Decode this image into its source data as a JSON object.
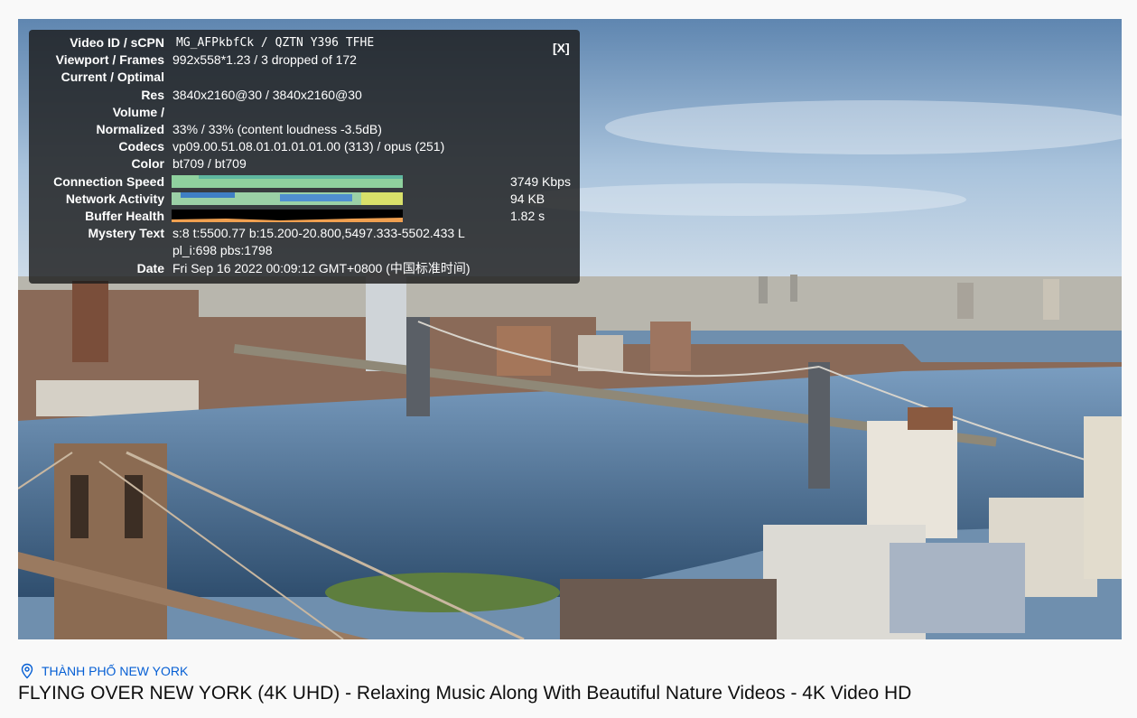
{
  "stats": {
    "close_label": "[X]",
    "rows": [
      {
        "label": "Video ID / sCPN",
        "value": "MG_AFPkbfCk / QZTN Y396 TFHE"
      },
      {
        "label": "Viewport / Frames",
        "value": "992x558*1.23 / 3 dropped of 172"
      },
      {
        "label": "Current / Optimal",
        "value": ""
      },
      {
        "label": "Res",
        "value": "3840x2160@30 / 3840x2160@30"
      },
      {
        "label": "Volume /",
        "value": ""
      },
      {
        "label": "Normalized",
        "value": "33% / 33% (content loudness -3.5dB)"
      },
      {
        "label": "Codecs",
        "value": "vp09.00.51.08.01.01.01.01.00 (313) / opus (251)"
      },
      {
        "label": "Color",
        "value": "bt709 / bt709"
      }
    ],
    "graphs": [
      {
        "label": "Connection Speed",
        "value": "3749 Kbps"
      },
      {
        "label": "Network Activity",
        "value": "94 KB"
      },
      {
        "label": "Buffer Health",
        "value": "1.82 s"
      }
    ],
    "mystery_label": "Mystery Text",
    "mystery_line1": "s:8 t:5500.77 b:15.200-20.800,5497.333-5502.433 L",
    "mystery_line2": "pl_i:698 pbs:1798",
    "date_label": "Date",
    "date_value": "Fri Sep 16 2022 00:09:12 GMT+0800 (中国标准时间)"
  },
  "location": "THÀNH PHỐ NEW YORK",
  "video_title": "FLYING OVER NEW YORK (4K UHD) - Relaxing Music Along With Beautiful Nature Videos - 4K Video HD",
  "colors": {
    "link": "#065fd4",
    "overlay_bg": "#1c1c1c",
    "speed_graph": "#8fd19e",
    "buffer_graph": "#f0a050"
  }
}
